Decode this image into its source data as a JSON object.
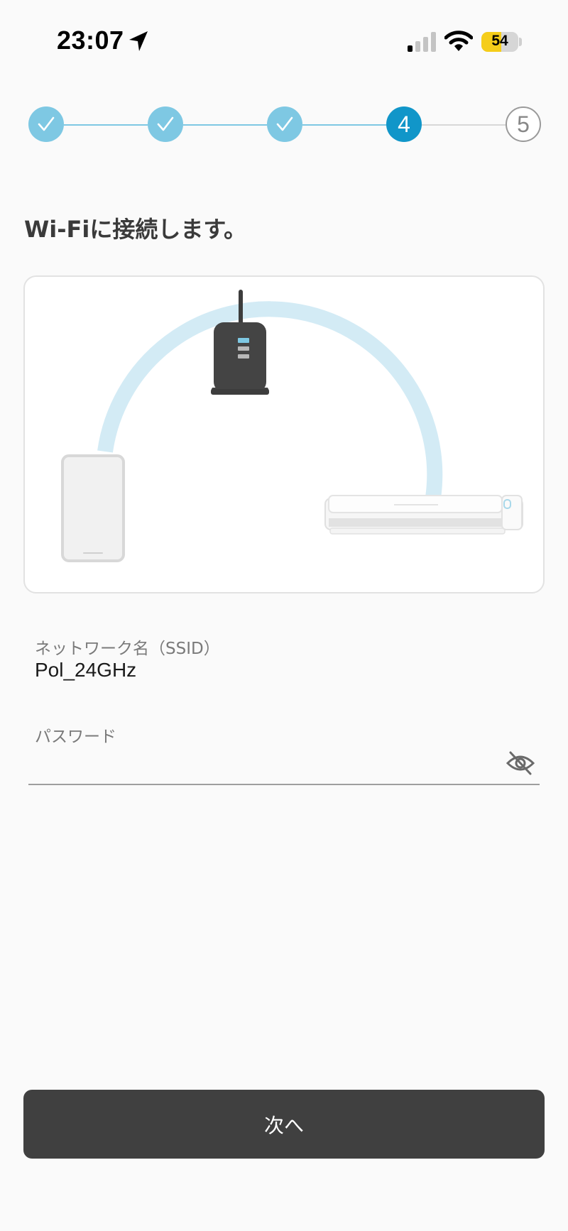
{
  "status_bar": {
    "time": "23:07",
    "battery": "54",
    "battery_level_percent": 54,
    "icons": [
      "location-arrow-icon",
      "cellular-signal-icon",
      "wifi-icon",
      "battery-icon"
    ],
    "battery_color": "#f5cd1a"
  },
  "stepper": {
    "steps": [
      {
        "state": "done",
        "icon": "checkmark-icon"
      },
      {
        "state": "done",
        "icon": "checkmark-icon"
      },
      {
        "state": "done",
        "icon": "checkmark-icon"
      },
      {
        "state": "current",
        "label": "4"
      },
      {
        "state": "pending",
        "label": "5"
      }
    ],
    "current_step": 4,
    "colors": {
      "done": "#7ec8e3",
      "current": "#1196c9",
      "pending": "#9a9a9a"
    }
  },
  "heading": "Wi-Fiに接続します。",
  "illustration": {
    "icons": [
      "smartphone-icon",
      "wifi-router-icon",
      "scanner-icon"
    ],
    "arc_color": "#d3ebf5"
  },
  "network": {
    "label": "ネットワーク名（SSID）",
    "value": "Pol_24GHz"
  },
  "password": {
    "label": "パスワード",
    "value": "",
    "toggle_icon": "eye-off-icon"
  },
  "next_button": {
    "label": "次へ",
    "color": "#404040"
  }
}
